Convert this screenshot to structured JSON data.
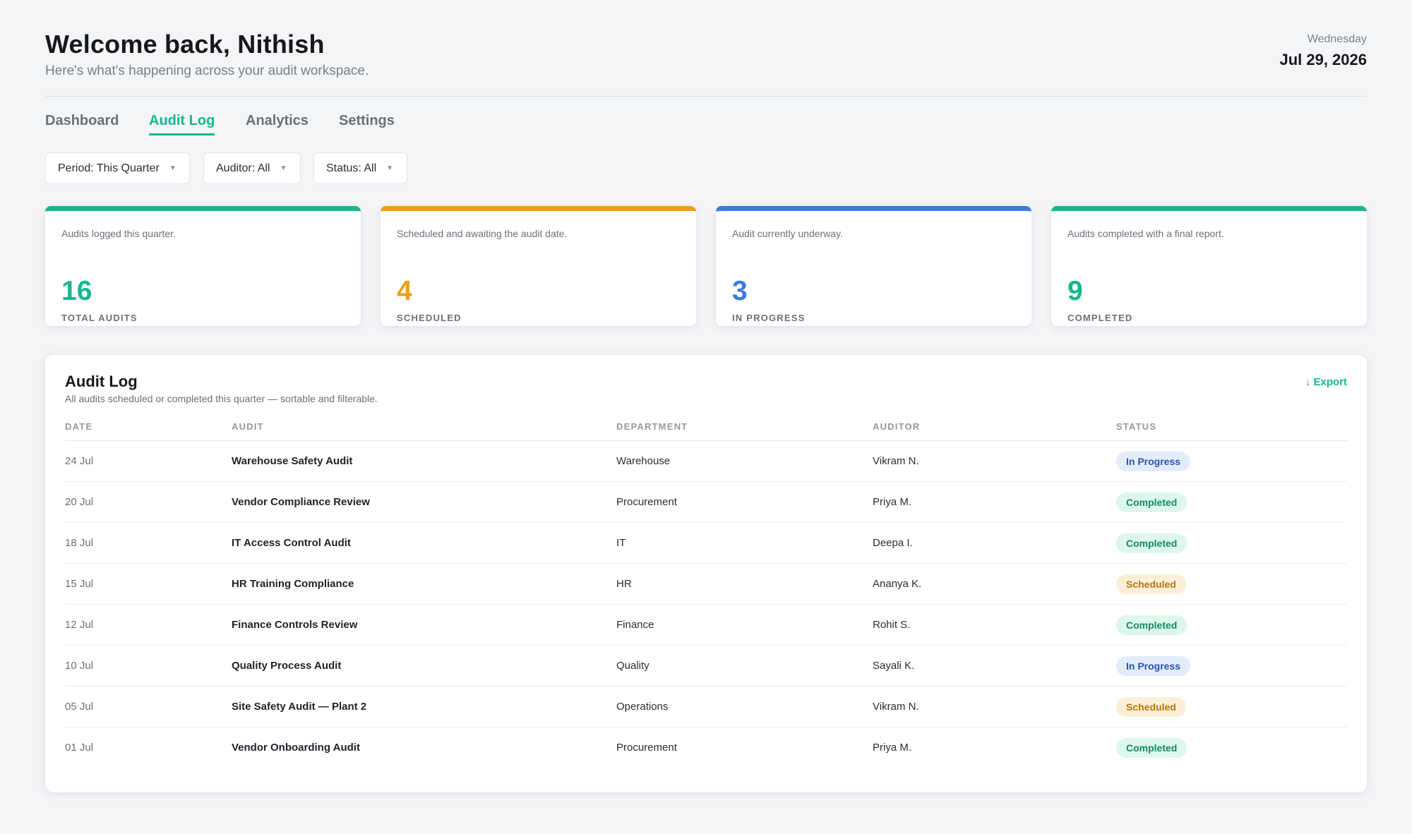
{
  "header": {
    "welcome": "Welcome back, Nithish",
    "subtitle": "Here's what's happening across your audit workspace.",
    "weekday": "Wednesday",
    "date": "Jul 29, 2026"
  },
  "tabs": [
    {
      "label": "Dashboard",
      "active": false
    },
    {
      "label": "Audit Log",
      "active": true
    },
    {
      "label": "Analytics",
      "active": false
    },
    {
      "label": "Settings",
      "active": false
    }
  ],
  "filters": [
    {
      "label": "Period: This Quarter"
    },
    {
      "label": "Auditor: All"
    },
    {
      "label": "Status: All"
    }
  ],
  "stats": [
    {
      "description": "Audits logged this quarter.",
      "value": "16",
      "label": "TOTAL AUDITS",
      "color": "#14b88f"
    },
    {
      "description": "Scheduled and awaiting the audit date.",
      "value": "4",
      "label": "SCHEDULED",
      "color": "#f09d12"
    },
    {
      "description": "Audit currently underway.",
      "value": "3",
      "label": "IN PROGRESS",
      "color": "#3b7ae0"
    },
    {
      "description": "Audits completed with a final report.",
      "value": "9",
      "label": "COMPLETED",
      "color": "#14b88f"
    }
  ],
  "audit_log": {
    "title": "Audit Log",
    "subtitle": "All audits scheduled or completed this quarter — sortable and filterable.",
    "export_label": "↓ Export",
    "columns": [
      "DATE",
      "AUDIT",
      "DEPARTMENT",
      "AUDITOR",
      "STATUS"
    ],
    "rows": [
      {
        "date": "24 Jul",
        "audit": "Warehouse Safety Audit",
        "department": "Warehouse",
        "auditor": "Vikram N.",
        "status": "In Progress"
      },
      {
        "date": "20 Jul",
        "audit": "Vendor Compliance Review",
        "department": "Procurement",
        "auditor": "Priya M.",
        "status": "Completed"
      },
      {
        "date": "18 Jul",
        "audit": "IT Access Control Audit",
        "department": "IT",
        "auditor": "Deepa I.",
        "status": "Completed"
      },
      {
        "date": "15 Jul",
        "audit": "HR Training Compliance",
        "department": "HR",
        "auditor": "Ananya K.",
        "status": "Scheduled"
      },
      {
        "date": "12 Jul",
        "audit": "Finance Controls Review",
        "department": "Finance",
        "auditor": "Rohit S.",
        "status": "Completed"
      },
      {
        "date": "10 Jul",
        "audit": "Quality Process Audit",
        "department": "Quality",
        "auditor": "Sayali K.",
        "status": "In Progress"
      },
      {
        "date": "05 Jul",
        "audit": "Site Safety Audit — Plant 2",
        "department": "Operations",
        "auditor": "Vikram N.",
        "status": "Scheduled"
      },
      {
        "date": "01 Jul",
        "audit": "Vendor Onboarding Audit",
        "department": "Procurement",
        "auditor": "Priya M.",
        "status": "Completed"
      }
    ]
  },
  "colors": {
    "accent": "#14b88f",
    "scheduled": "#f09d12",
    "in_progress": "#3b7ae0"
  }
}
